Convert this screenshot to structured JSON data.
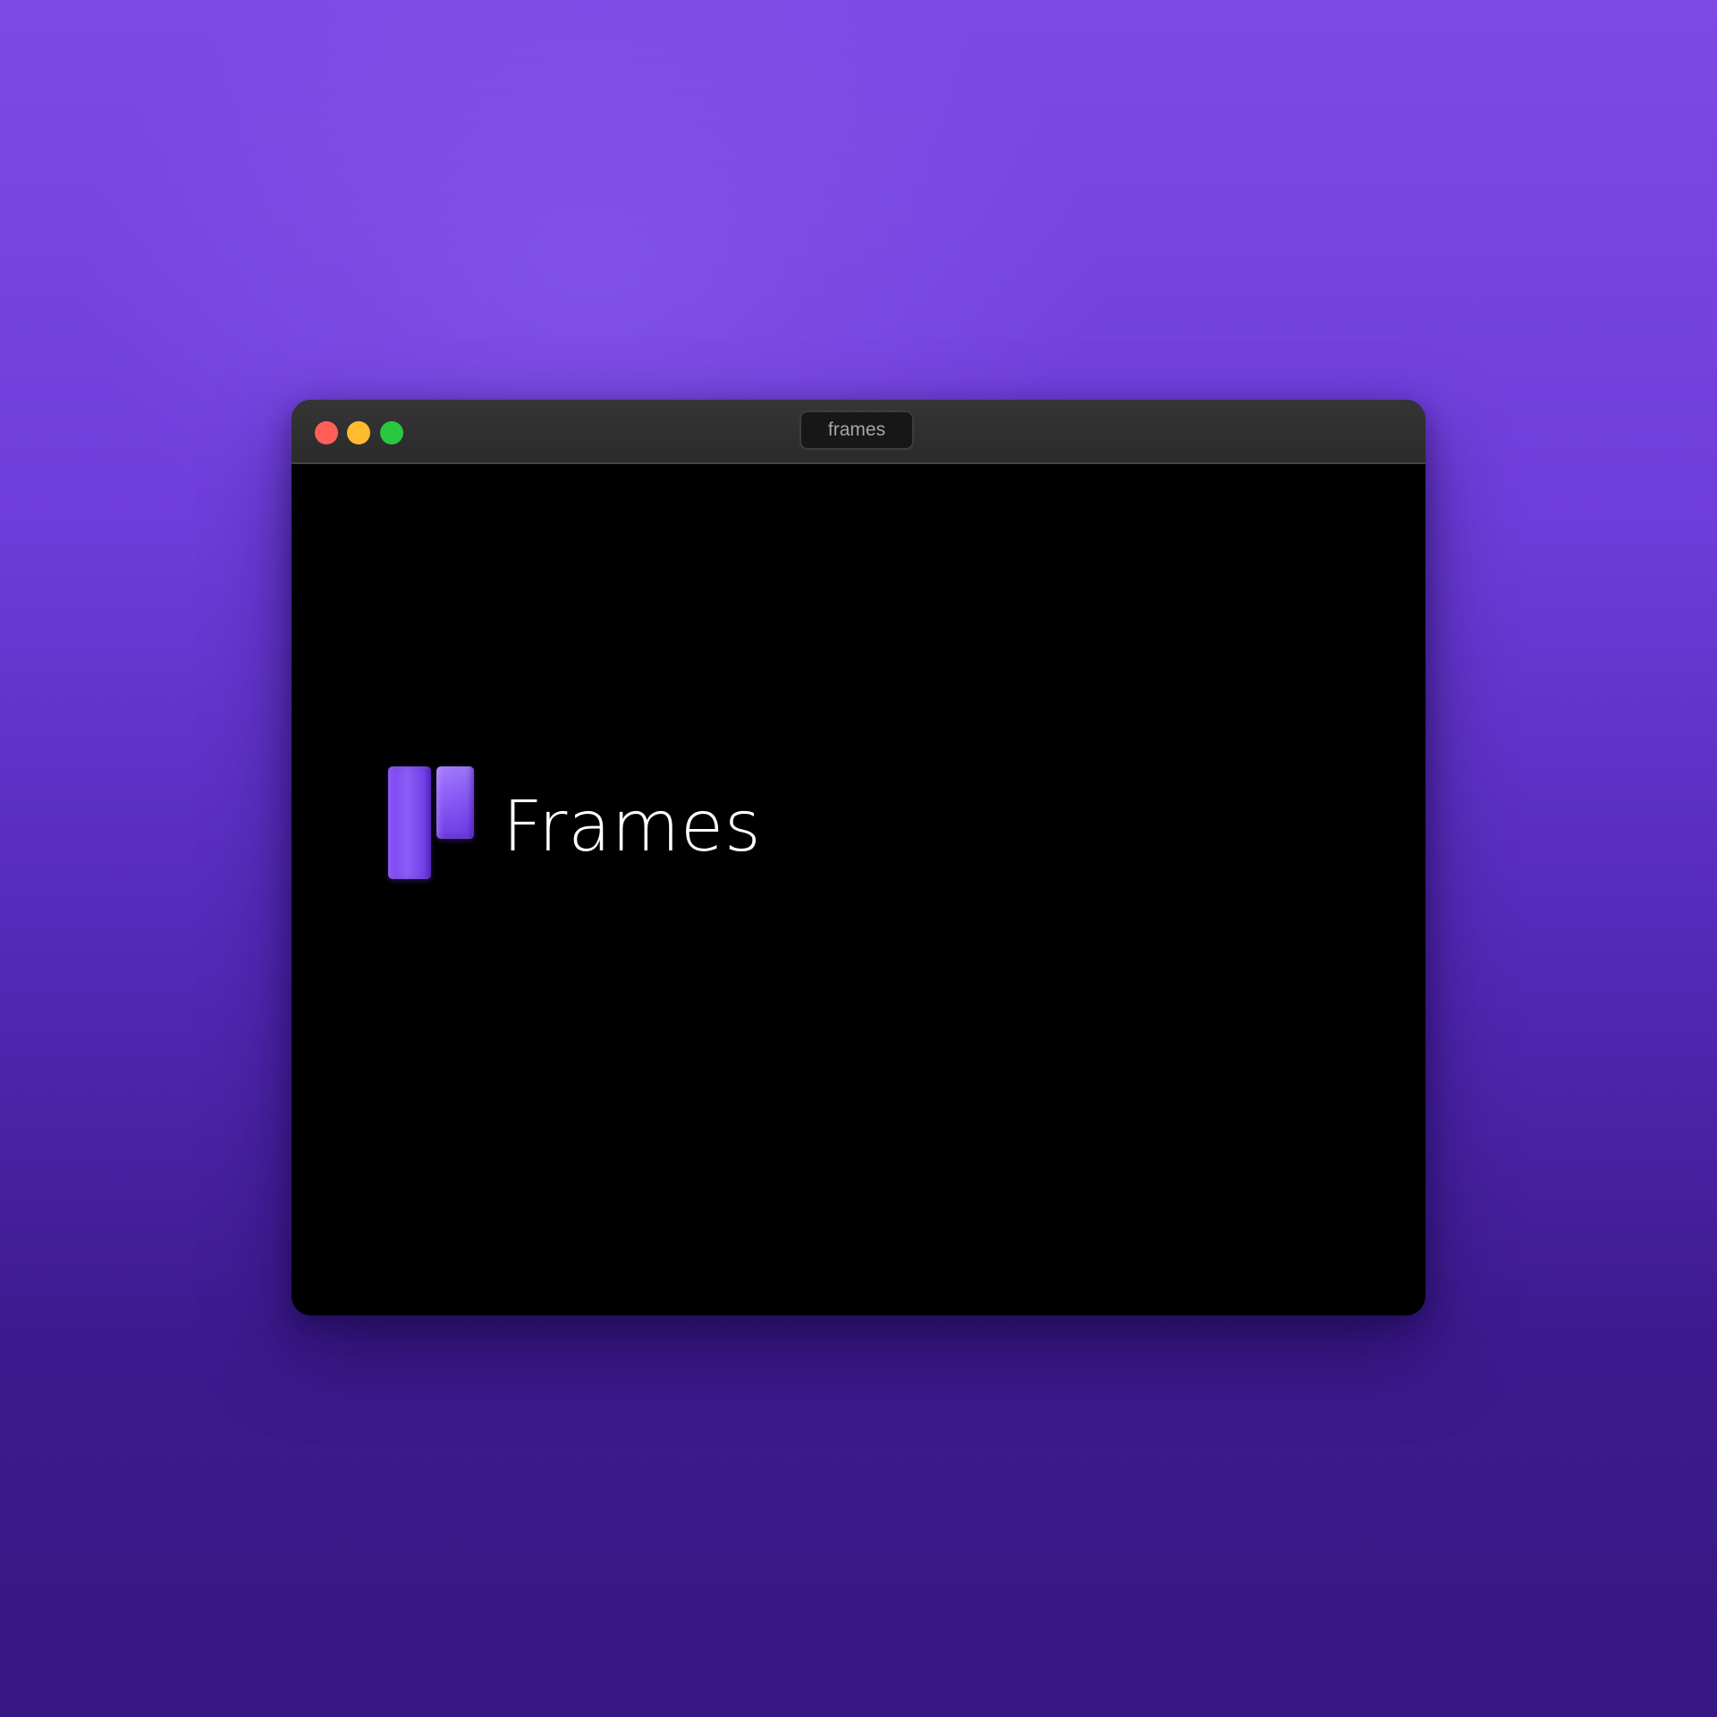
{
  "window": {
    "title": "frames",
    "controls": {
      "close_color": "#ff5f57",
      "minimize_color": "#febc2e",
      "zoom_color": "#28c840"
    }
  },
  "splash": {
    "logo_icon": "frames-logo-icon",
    "brand_name": "Frames",
    "accent_color": "#7a44f0"
  }
}
